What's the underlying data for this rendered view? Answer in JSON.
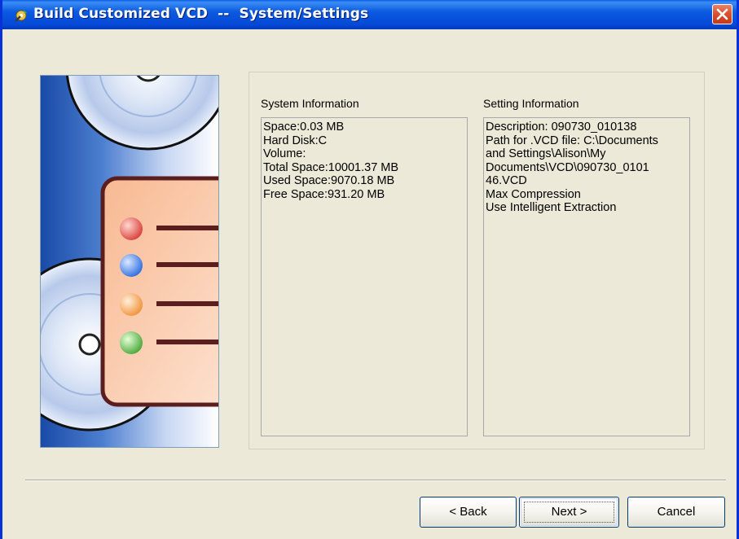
{
  "window": {
    "title": "Build Customized VCD  --  System/Settings",
    "close_icon": "close-icon",
    "app_icon": "app-wizard-icon"
  },
  "system_info": {
    "label": "System Information",
    "lines": [
      "Space:0.03 MB",
      "",
      "Hard Disk:C",
      "Volume:",
      "Total Space:10001.37 MB",
      "Used Space:9070.18 MB",
      "Free Space:931.20 MB"
    ]
  },
  "setting_info": {
    "label": "Setting Information",
    "lines": [
      "Description: 090730_010138",
      "Path for .VCD file: C:\\Documents",
      "and Settings\\Alison\\My",
      "Documents\\VCD\\090730_0101",
      "46.VCD",
      "",
      "Max Compression",
      "Use Intelligent Extraction"
    ]
  },
  "buttons": {
    "back": "< Back",
    "next": "Next >",
    "cancel": "Cancel"
  },
  "colors": {
    "title_bar": "#0549d6",
    "dialog_bg": "#ece9d8",
    "close_button": "#d9542e"
  }
}
